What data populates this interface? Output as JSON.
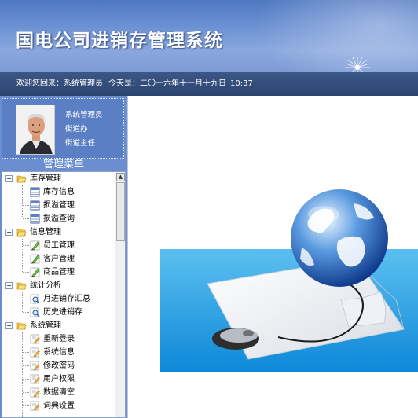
{
  "header": {
    "title": "国电公司进销存管理系统"
  },
  "statusbar": {
    "welcome": "欢迎您回来：系统管理员",
    "date": "今天是：二〇一六年十一月十九日",
    "time": "10:37"
  },
  "user": {
    "role": "系统管理员",
    "department": "街道办",
    "position": "街道主任"
  },
  "menu": {
    "title": "管理菜单",
    "groups": [
      {
        "label": "库存管理",
        "items": [
          "库存信息",
          "损溢管理",
          "损溢查询"
        ]
      },
      {
        "label": "信息管理",
        "items": [
          "员工管理",
          "客户管理",
          "商品管理"
        ]
      },
      {
        "label": "统计分析",
        "items": [
          "月进销存汇总",
          "历史进销存"
        ]
      },
      {
        "label": "系统管理",
        "items": [
          "重新登录",
          "系统信息",
          "修改密码",
          "用户权限",
          "数据清空",
          "词典设置"
        ]
      }
    ]
  },
  "icons": {
    "folder": "folder-open-icon",
    "table": "table-icon",
    "edit": "pencil-icon",
    "search": "magnifier-icon",
    "doc": "document-edit-icon"
  },
  "colors": {
    "header_blue": "#5a80c8",
    "statusbar": "#33507e",
    "panel": "#6a8ed0",
    "banner_blue": "#2aa0e0"
  }
}
